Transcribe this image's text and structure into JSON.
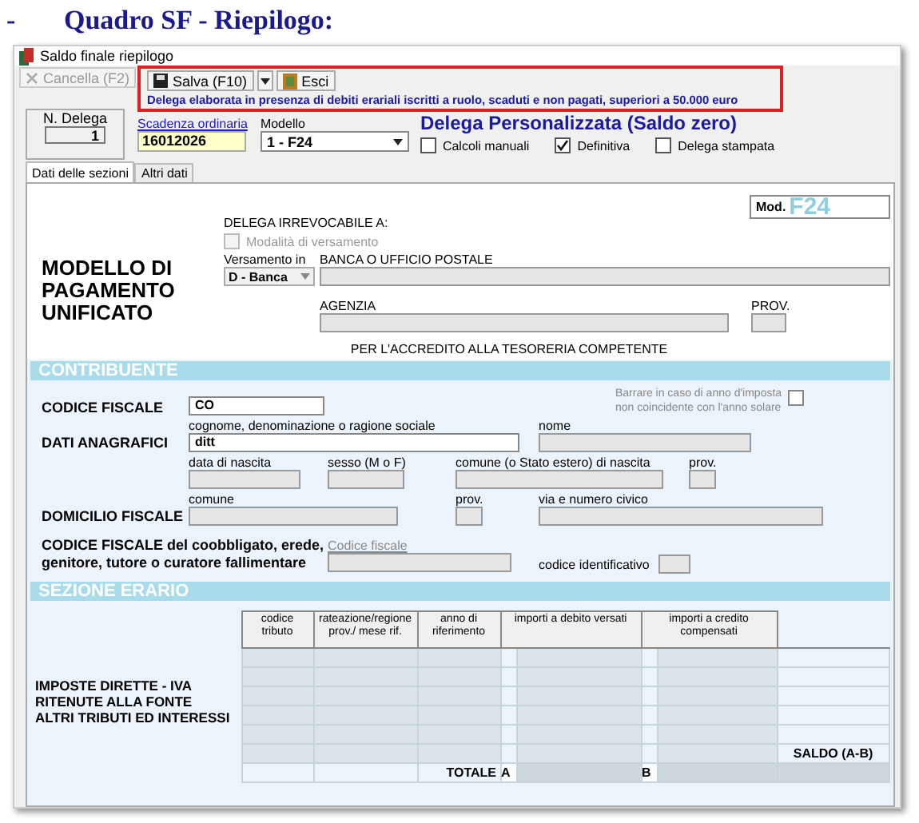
{
  "heading": {
    "dash": "-",
    "text": "Quadro SF - Riepilogo:"
  },
  "window": {
    "title": "Saldo finale riepilogo"
  },
  "toolbar": [
    {
      "kind": "delete",
      "label": "Cancella (F2)",
      "disabled": true
    },
    {
      "kind": "save",
      "label": "Salva (F10)",
      "disabled": false
    },
    {
      "kind": "exit",
      "label": "Esci",
      "disabled": false
    }
  ],
  "notice": "Delega elaborata in presenza di debiti erariali iscritti a ruolo, scaduti e non pagati, superiori a 50.000 euro",
  "delega_number": {
    "label": "N. Delega",
    "value": "1"
  },
  "scadenza": {
    "label": "Scadenza ordinaria",
    "value": "16012026"
  },
  "modello": {
    "label": "Modello",
    "value": "1 - F24"
  },
  "delega_title": "Delega Personalizzata (Saldo zero)",
  "options": [
    {
      "label": "Calcoli manuali",
      "checked": false
    },
    {
      "label": "Definitiva",
      "checked": true
    },
    {
      "label": "Delega stampata",
      "checked": false
    }
  ],
  "tabs": [
    {
      "label": "Dati delle sezioni",
      "selected": true
    },
    {
      "label": "Altri dati",
      "selected": false
    }
  ],
  "form": {
    "title": "MODELLO DI\nPAGAMENTO\nUNIFICATO",
    "delega_label": "DELEGA IRREVOCABILE A:",
    "mod_prefix": "Mod.",
    "mod_code": "F24",
    "modalita": {
      "label": "Modalità di versamento",
      "checked": false,
      "disabled": true
    },
    "versamento": {
      "label": "Versamento in",
      "value": "D - Banca"
    },
    "banca_label": "BANCA O UFFICIO POSTALE",
    "agenzia_label": "AGENZIA",
    "prov_label": "PROV.",
    "accredito": "PER L'ACCREDITO ALLA TESORERIA COMPETENTE"
  },
  "contribuente": {
    "title": "CONTRIBUENTE",
    "codice_fiscale": {
      "label": "CODICE FISCALE",
      "value": "CO"
    },
    "anno_note": {
      "text": "Barrare in caso di anno d'imposta\nnon coincidente con l'anno solare",
      "checked": false
    },
    "dati_anagrafici": {
      "label": "DATI ANAGRAFICI",
      "fields": [
        {
          "label": "cognome, denominazione o ragione sociale",
          "value": "ditt"
        },
        {
          "label": "nome"
        }
      ]
    },
    "nascita": [
      {
        "label": "data di nascita"
      },
      {
        "label": "sesso (M o F)"
      },
      {
        "label": "comune (o Stato estero) di nascita"
      },
      {
        "label": "prov."
      }
    ],
    "domicilio": {
      "label": "DOMICILIO FISCALE",
      "fields": [
        {
          "label": "comune"
        },
        {
          "label": "prov."
        },
        {
          "label": "via e numero civico"
        }
      ]
    },
    "coobbligato": {
      "label": "CODICE FISCALE del coobbligato, erede,\ngenitore, tutore o curatore fallimentare",
      "field_label": "Codice fiscale",
      "id_label": "codice identificativo"
    }
  },
  "erario": {
    "title": "SEZIONE ERARIO",
    "side_label": "IMPOSTE DIRETTE - IVA\nRITENUTE ALLA FONTE\nALTRI TRIBUTI ED INTERESSI",
    "columns": [
      "codice\ntributo",
      "rateazione/regione\nprov./ mese rif.",
      "anno di\nriferimento",
      "importi a debito versati",
      "importi a credito\ncompensati"
    ],
    "saldo_label": "SALDO (A-B)",
    "totale_label": "TOTALE",
    "debit_mark": "A",
    "credit_mark": "B"
  }
}
